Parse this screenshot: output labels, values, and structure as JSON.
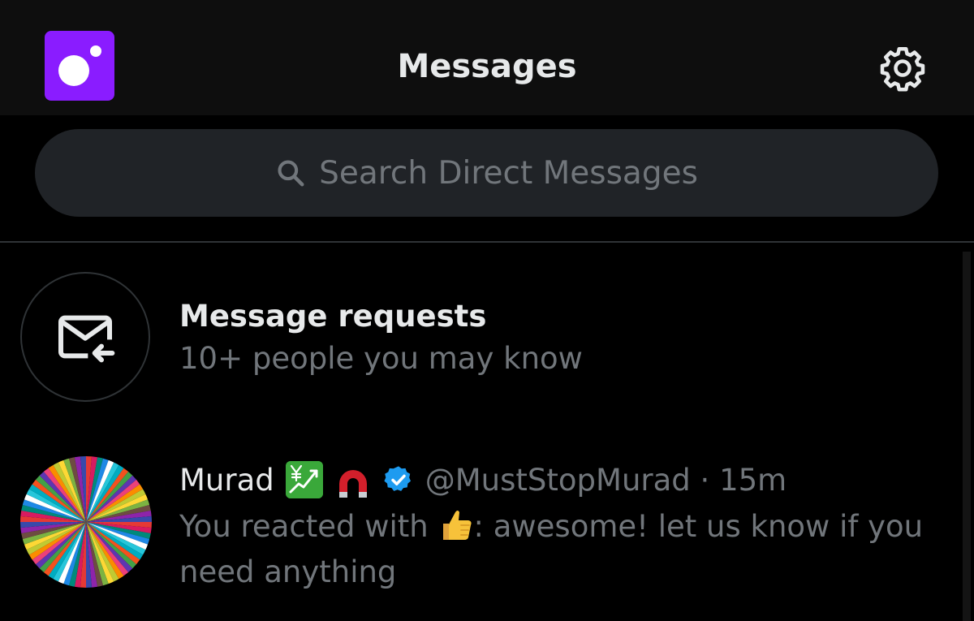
{
  "header": {
    "title": "Messages",
    "logo_icon": "app-logo-icon",
    "settings_icon": "gear-icon"
  },
  "search": {
    "placeholder": "Search Direct Messages",
    "icon": "search-icon"
  },
  "message_requests": {
    "title": "Message requests",
    "subtitle": "10+ people you may know",
    "icon": "envelope-incoming-icon"
  },
  "conversations": [
    {
      "name": "Murad",
      "name_emojis": [
        "chart-yen-emoji",
        "magnet-emoji"
      ],
      "verified": true,
      "handle": "@MustStopMurad",
      "separator": "·",
      "time": "15m",
      "preview_prefix": "You reacted with",
      "reaction_emoji": "thumbs-up-emoji",
      "preview_suffix": ": awesome! let us know if you need anything"
    }
  ],
  "colors": {
    "background": "#000000",
    "header_background": "#0e0e0e",
    "brand_purple": "#8a1cff",
    "primary_text": "#e7e9ea",
    "secondary_text": "#71767b",
    "verified_blue": "#1d9bf0",
    "search_background": "#202327"
  }
}
